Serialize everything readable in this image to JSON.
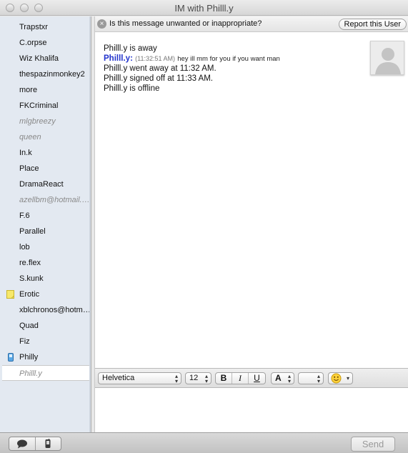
{
  "window": {
    "title": "IM with Philll.y"
  },
  "buddies": [
    {
      "name": "Trapstxr",
      "state": "online",
      "icon": ""
    },
    {
      "name": "C.orpse",
      "state": "online",
      "icon": ""
    },
    {
      "name": "Wiz Khalifa",
      "state": "online",
      "icon": ""
    },
    {
      "name": "thespazinmonkey2",
      "state": "online",
      "icon": ""
    },
    {
      "name": "more",
      "state": "online",
      "icon": ""
    },
    {
      "name": "FKCriminal",
      "state": "online",
      "icon": ""
    },
    {
      "name": "mlgbreezy",
      "state": "idle",
      "icon": ""
    },
    {
      "name": "queen",
      "state": "idle",
      "icon": ""
    },
    {
      "name": "In.k",
      "state": "online",
      "icon": ""
    },
    {
      "name": "Place",
      "state": "online",
      "icon": ""
    },
    {
      "name": "DramaReact",
      "state": "online",
      "icon": ""
    },
    {
      "name": "azellbm@hotmail.com",
      "state": "idle",
      "icon": ""
    },
    {
      "name": "F.6",
      "state": "online",
      "icon": ""
    },
    {
      "name": "Parallel",
      "state": "online",
      "icon": ""
    },
    {
      "name": "lob",
      "state": "online",
      "icon": ""
    },
    {
      "name": "re.flex",
      "state": "online",
      "icon": ""
    },
    {
      "name": "S.kunk",
      "state": "online",
      "icon": ""
    },
    {
      "name": "Erotic",
      "state": "online",
      "icon": "note-icon"
    },
    {
      "name": "xblchronos@hotmail.com",
      "state": "online",
      "icon": ""
    },
    {
      "name": "Quad",
      "state": "online",
      "icon": ""
    },
    {
      "name": "Fiz",
      "state": "online",
      "icon": ""
    },
    {
      "name": "Philly",
      "state": "online",
      "icon": "mobile-phone-icon"
    },
    {
      "name": "Philll.y",
      "state": "selected",
      "icon": ""
    }
  ],
  "warning": {
    "text": "Is this message unwanted or inappropriate?",
    "report_label": "Report this User"
  },
  "transcript": [
    {
      "type": "status",
      "text": "Philll.y is away"
    },
    {
      "type": "message",
      "sender": "Philll.y:",
      "time": "(11:32:51 AM)",
      "text": "hey ill mm for you if you want man"
    },
    {
      "type": "status",
      "text": "Philll.y went away at 11:32 AM."
    },
    {
      "type": "status",
      "text": "Philll.y signed off at 11:33 AM."
    },
    {
      "type": "status",
      "text": "Philll.y is offline"
    }
  ],
  "format": {
    "font": "Helvetica",
    "size": "12",
    "bold": "B",
    "italic": "I",
    "underline": "U",
    "color_label": "A",
    "emoji": "smiley-icon"
  },
  "bottom": {
    "send_label": "Send"
  },
  "colors": {
    "sender": "#2233cc",
    "sidebar_bg": "#e3e9f1",
    "idle_text": "#8a8a8a"
  }
}
